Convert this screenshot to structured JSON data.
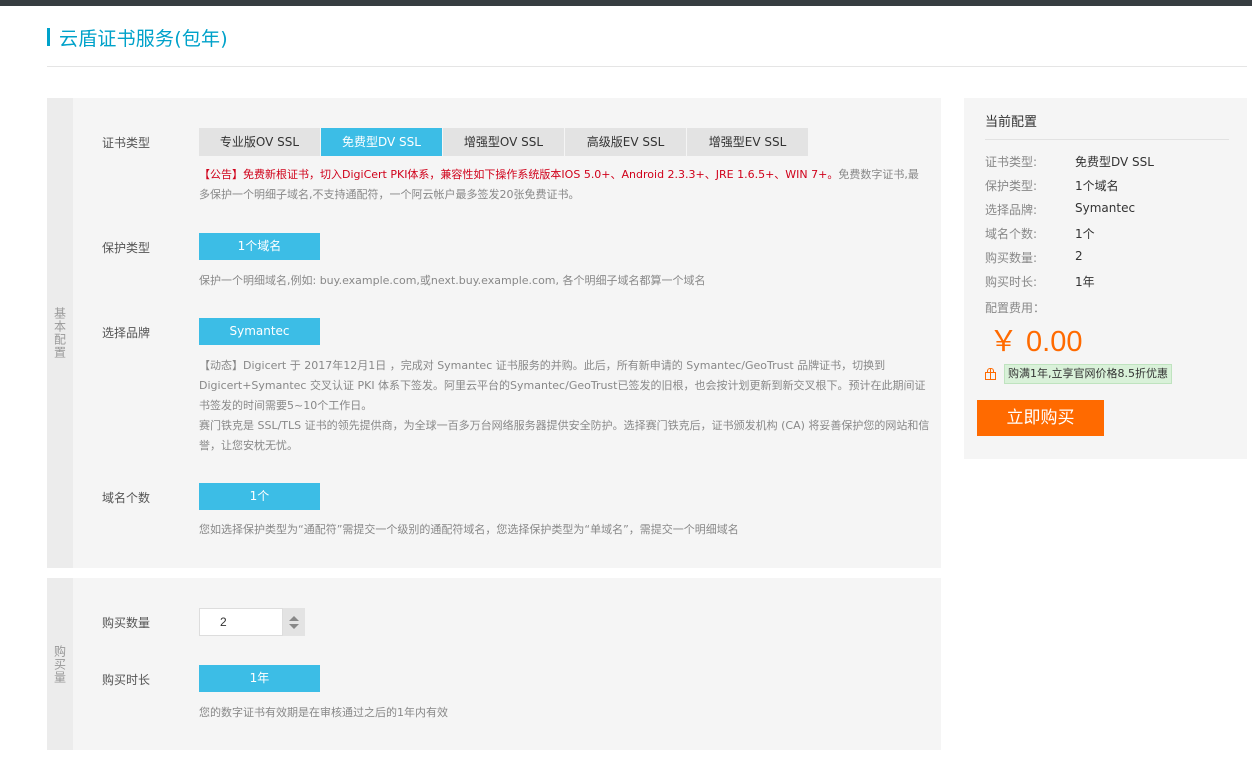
{
  "page": {
    "title": "云盾证书服务(包年)"
  },
  "basic": {
    "section_label": "基本配置",
    "cert_type": {
      "label": "证书类型",
      "tabs": [
        "专业版OV SSL",
        "免费型DV SSL",
        "增强型OV SSL",
        "高级版EV SSL",
        "增强型EV SSL"
      ],
      "selected": "免费型DV SSL",
      "notice_red": "【公告】免费新根证书，切入DigiCert PKI体系，兼容性如下操作系统版本IOS 5.0+、Android 2.3.3+、JRE 1.6.5+、WIN 7+。",
      "notice_gray": "免费数字证书,最多保护一个明细子域名,不支持通配符，一个阿云帐户最多签发20张免费证书。"
    },
    "protect_type": {
      "label": "保护类型",
      "option": "1个域名",
      "help": "保护一个明细域名,例如: buy.example.com,或next.buy.example.com, 各个明细子域名都算一个域名"
    },
    "brand": {
      "label": "选择品牌",
      "option": "Symantec",
      "desc1": "【动态】Digicert 于 2017年12月1日 ，完成对 Symantec 证书服务的并购。此后，所有新申请的 Symantec/GeoTrust 品牌证书，切换到 Digicert+Symantec 交叉认证 PKI 体系下签发。阿里云平台的Symantec/GeoTrust已签发的旧根，也会按计划更新到新交叉根下。预计在此期间证书签发的时间需要5~10个工作日。",
      "desc2": "赛门铁克是 SSL/TLS 证书的领先提供商，为全球一百多万台网络服务器提供安全防护。选择赛门铁克后，证书颁发机构 (CA) 将妥善保护您的网站和信誉，让您安枕无忧。"
    },
    "domain_count": {
      "label": "域名个数",
      "option": "1个",
      "help": "您如选择保护类型为“通配符”需提交一个级别的通配符域名，您选择保护类型为“单域名”，需提交一个明细域名"
    }
  },
  "purchase": {
    "section_label": "购买量",
    "quantity": {
      "label": "购买数量",
      "value": "2"
    },
    "duration": {
      "label": "购买时长",
      "option": "1年",
      "help": "您的数字证书有效期是在审核通过之后的1年内有效"
    }
  },
  "summary": {
    "title": "当前配置",
    "rows": [
      {
        "k": "证书类型:",
        "v": "免费型DV SSL"
      },
      {
        "k": "保护类型:",
        "v": "1个域名"
      },
      {
        "k": "选择品牌:",
        "v": "Symantec"
      },
      {
        "k": "域名个数:",
        "v": "1个"
      },
      {
        "k": "购买数量:",
        "v": "2"
      },
      {
        "k": "购买时长:",
        "v": "1年"
      }
    ],
    "fee_label": "配置费用：",
    "price": "￥ 0.00",
    "promo": "购满1年,立享官网价格8.5折优惠",
    "buy_button": "立即购买"
  },
  "colors": {
    "accent": "#3cbde6",
    "title": "#00a2ca",
    "orange": "#ff6a00",
    "notice_red": "#d0021b"
  }
}
